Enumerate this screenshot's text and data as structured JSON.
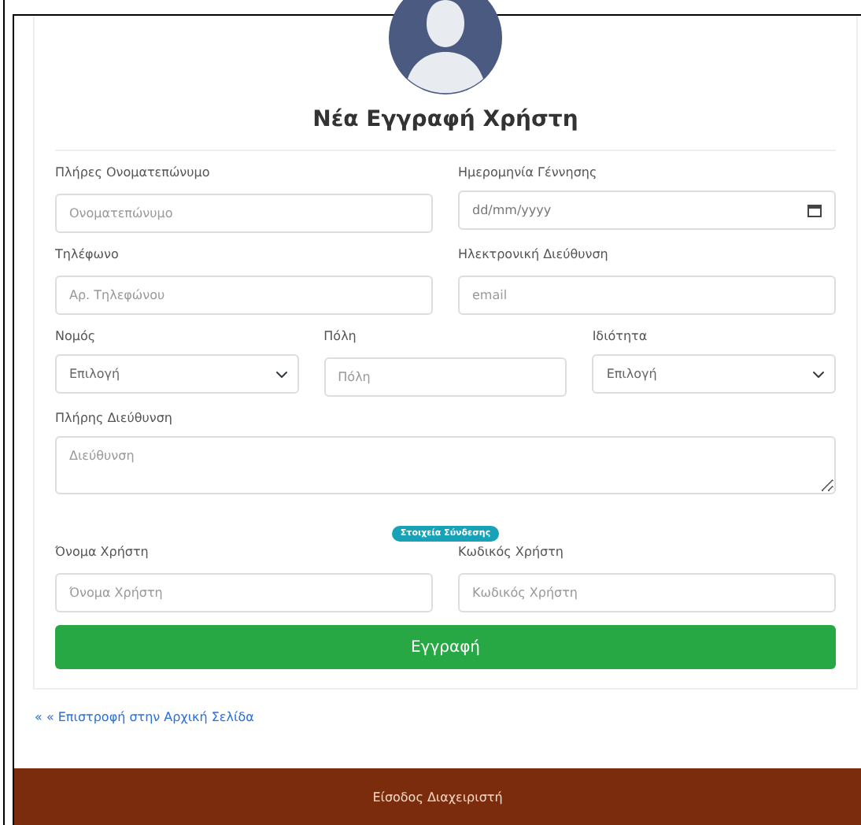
{
  "title": "Νέα Εγγραφή Χρήστη",
  "rows": [
    [
      {
        "kind": "input",
        "label": "Πλήρες Ονοματεπώνυμο",
        "placeholder": "Ονοματεπώνυμο"
      },
      {
        "kind": "date",
        "label": "Ημερομηνία Γέννησης",
        "placeholder": "dd/mm/yyyy"
      }
    ],
    [
      {
        "kind": "input",
        "label": "Τηλέφωνο",
        "placeholder": "Αρ. Τηλεφώνου"
      },
      {
        "kind": "input",
        "label": "Ηλεκτρονική Διεύθυνση",
        "placeholder": "email"
      }
    ],
    [
      {
        "kind": "select",
        "label": "Νομός",
        "value": "Επιλογή"
      },
      {
        "kind": "input",
        "label": "Πόλη",
        "placeholder": "Πόλη"
      },
      {
        "kind": "select",
        "label": "Ιδιότητα",
        "value": "Επιλογή"
      }
    ],
    [
      {
        "kind": "textarea",
        "label": "Πλήρης Διεύθυνση",
        "placeholder": "Διεύθυνση"
      }
    ],
    [
      {
        "kind": "badge",
        "text": "Στοιχεία Σύνδεσης"
      }
    ],
    [
      {
        "kind": "input",
        "label": "Όνομα Χρήστη",
        "placeholder": "Όνομα Χρήστη"
      },
      {
        "kind": "input",
        "label": "Κωδικός Χρήστη",
        "placeholder": "Κωδικός Χρήστη"
      }
    ]
  ],
  "submit": "Εγγραφή",
  "back_link": "« « Επιστροφή στην Αρχική Σελίδα",
  "footer": {
    "admin_link": "Είσοδος Διαχειριστή"
  }
}
